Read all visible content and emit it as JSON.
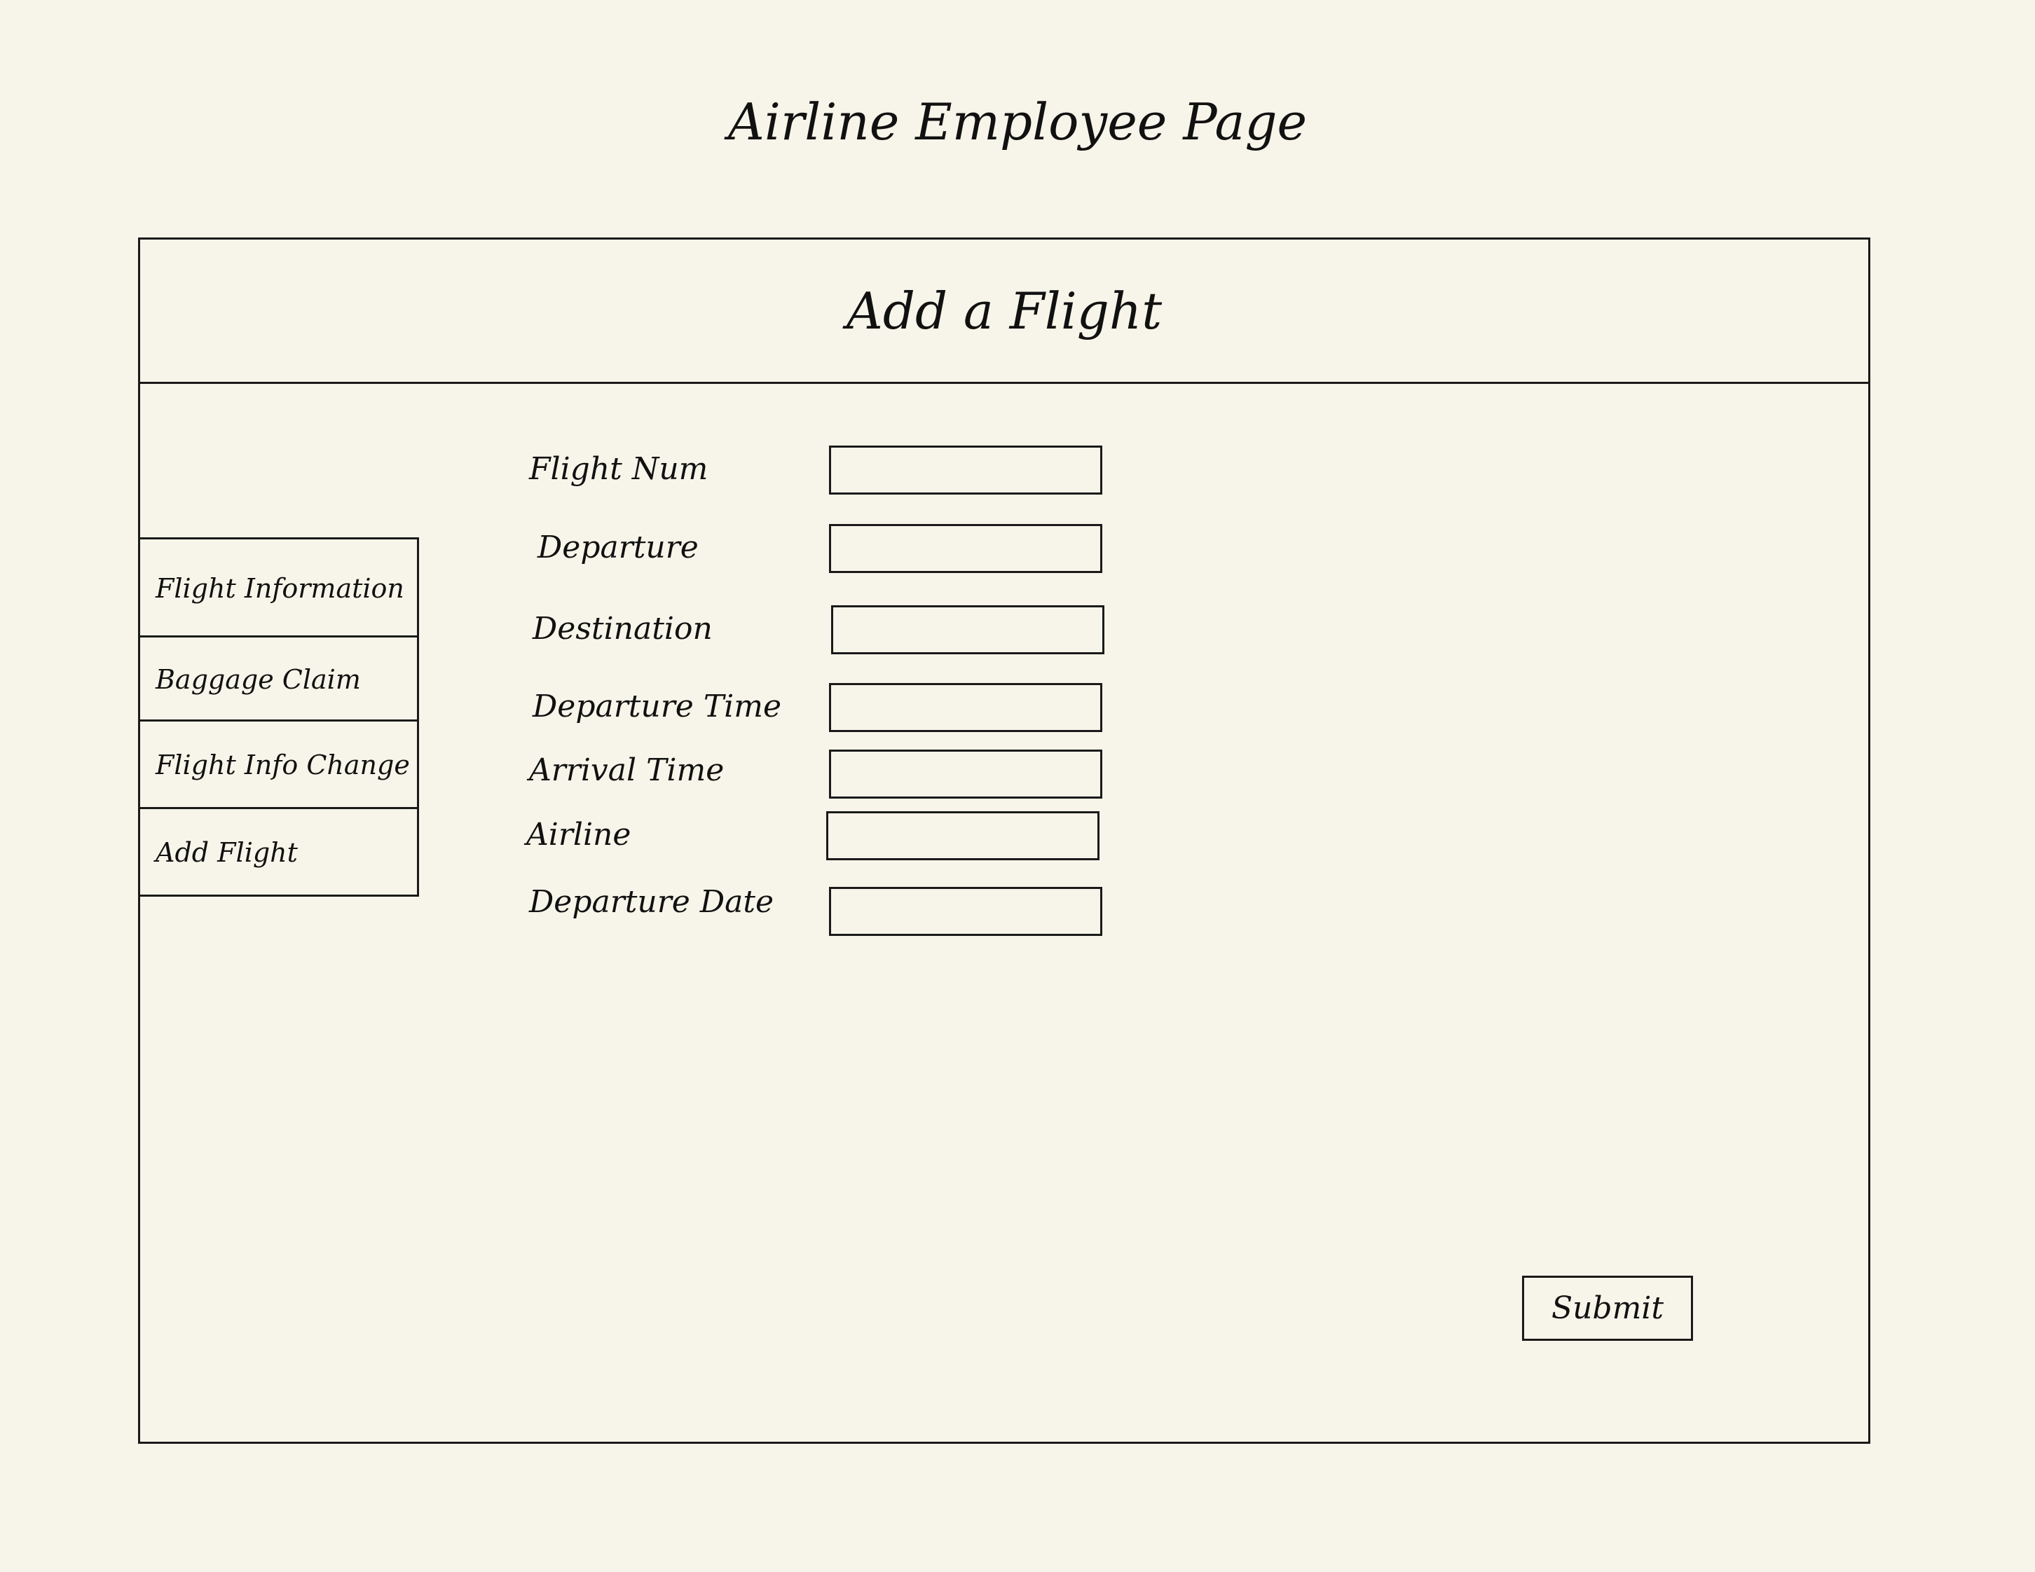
{
  "page": {
    "title": "Airline Employee Page"
  },
  "panel": {
    "title": "Add a Flight"
  },
  "sidebar": {
    "items": [
      {
        "label": "Flight Information"
      },
      {
        "label": "Baggage Claim"
      },
      {
        "label": "Flight Info Change"
      },
      {
        "label": "Add Flight"
      }
    ]
  },
  "form": {
    "fields": [
      {
        "label": "Flight Num",
        "value": ""
      },
      {
        "label": "Departure",
        "value": ""
      },
      {
        "label": "Destination",
        "value": ""
      },
      {
        "label": "Departure Time",
        "value": ""
      },
      {
        "label": "Arrival Time",
        "value": ""
      },
      {
        "label": "Airline",
        "value": ""
      },
      {
        "label": "Departure Date",
        "value": ""
      }
    ],
    "submit_label": "Submit"
  }
}
